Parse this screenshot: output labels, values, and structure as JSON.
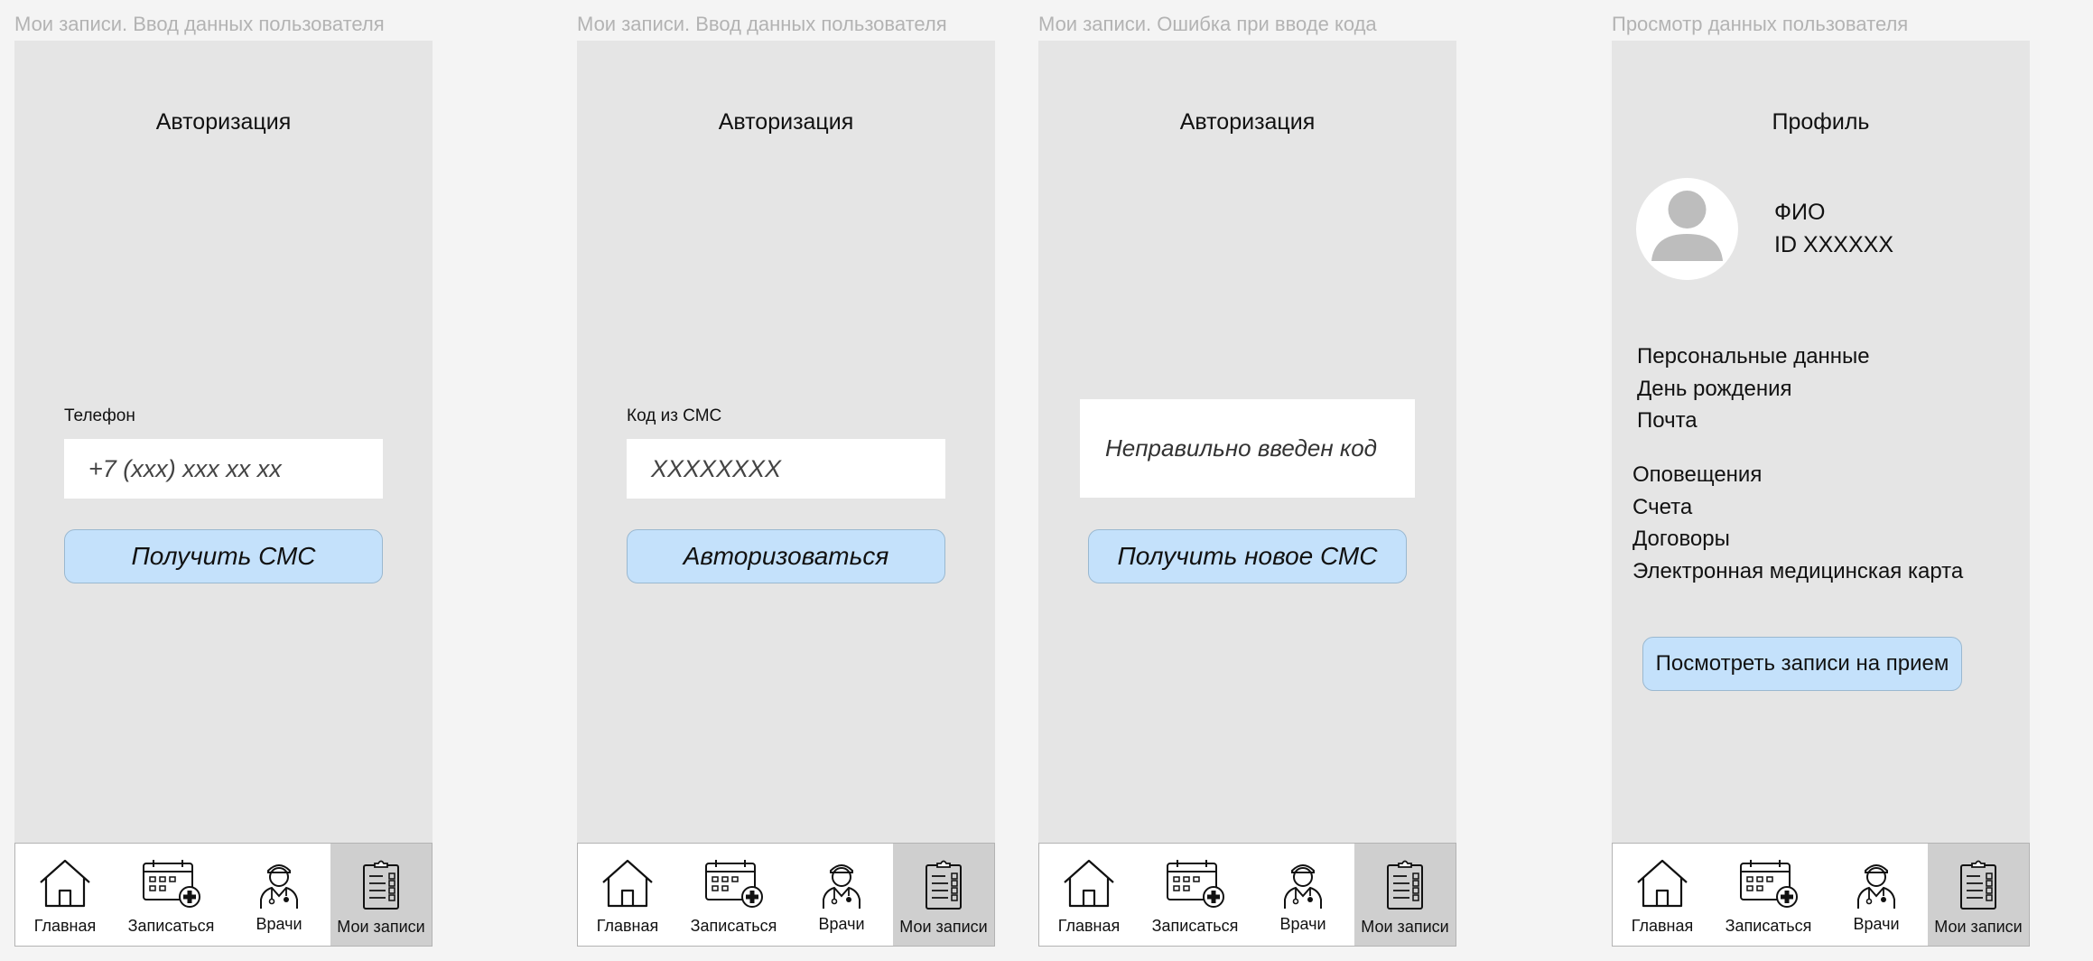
{
  "screens": [
    {
      "caption": "Мои записи. Ввод данных пользователя",
      "title": "Авторизация",
      "field_label": "Телефон",
      "field_placeholder": "+7 (xxx) xxx xx xx",
      "button": "Получить СМС"
    },
    {
      "caption": "Мои записи. Ввод данных пользователя",
      "title": "Авторизация",
      "field_label": "Код из СМС",
      "field_placeholder": "XXXXXXXX",
      "button": "Авторизоваться"
    },
    {
      "caption": "Мои записи. Ошибка при вводе кода",
      "title": "Авторизация",
      "error": "Неправильно введен код",
      "button": "Получить новое СМС"
    },
    {
      "caption": "Просмотр данных пользователя",
      "title": "Профиль",
      "name": "ФИО",
      "id": "ID XXXXXX",
      "personal": [
        "Персональные данные",
        "День рождения",
        "Почта"
      ],
      "menu": [
        "Оповещения",
        "Счета",
        "Договоры",
        "Электронная медицинская карта"
      ],
      "button": "Посмотреть записи на прием"
    }
  ],
  "tabbar": {
    "home": "Главная",
    "book": "Записаться",
    "doctors": "Врачи",
    "records": "Мои записи",
    "active": "records",
    "icons": [
      "house-icon",
      "calendar-plus-icon",
      "doctor-icon",
      "clipboard-list-icon"
    ]
  },
  "colors": {
    "accent": "#c4e1fb",
    "frame": "#e5e5e5",
    "active_tab": "#cfcfcf"
  }
}
